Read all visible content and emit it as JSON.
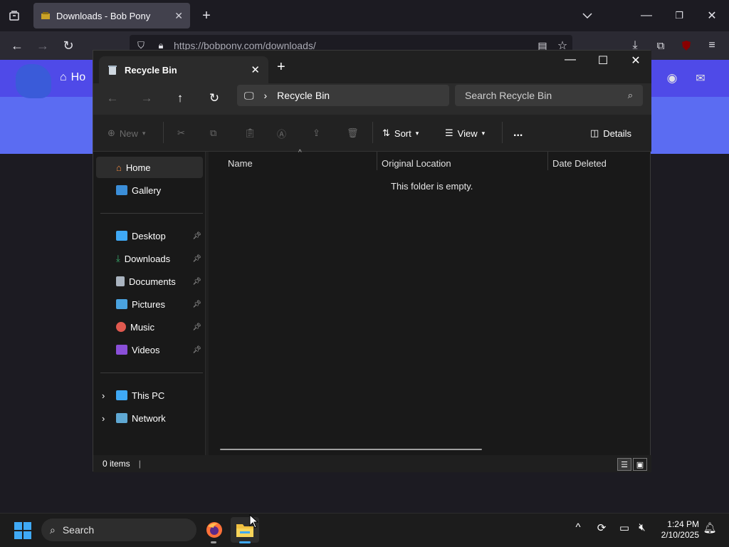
{
  "browser": {
    "tab_title": "Downloads - Bob Pony",
    "url": "https://bobpony.com/downloads/",
    "site_nav_home": "Ho"
  },
  "explorer": {
    "tab_title": "Recycle Bin",
    "breadcrumb": "Recycle Bin",
    "search_placeholder": "Search Recycle Bin",
    "toolbar": {
      "new_label": "New",
      "sort_label": "Sort",
      "view_label": "View",
      "more_label": "...",
      "details_label": "Details"
    },
    "nav": {
      "home": "Home",
      "gallery": "Gallery",
      "desktop": "Desktop",
      "downloads": "Downloads",
      "documents": "Documents",
      "pictures": "Pictures",
      "music": "Music",
      "videos": "Videos",
      "this_pc": "This PC",
      "network": "Network"
    },
    "columns": {
      "name": "Name",
      "original_location": "Original Location",
      "date_deleted": "Date Deleted"
    },
    "empty_message": "This folder is empty.",
    "status": "0 items"
  },
  "taskbar": {
    "search_label": "Search",
    "time": "1:24 PM",
    "date": "2/10/2025"
  },
  "colors": {
    "accent": "#3fa9f5",
    "site_banner": "#4f4ae8",
    "explorer_bg": "#191919"
  }
}
